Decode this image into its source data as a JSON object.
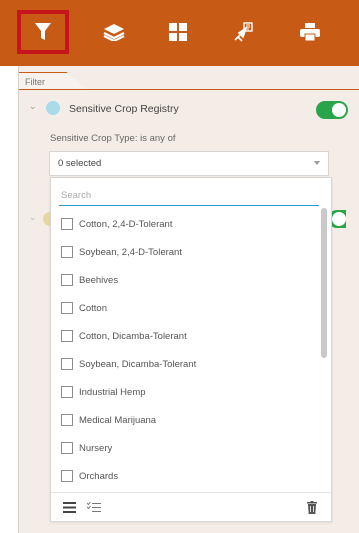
{
  "toolbar": {
    "active": "filter",
    "colors": {
      "bar": "#c75a14",
      "active_border": "#c4161c"
    }
  },
  "panel": {
    "tab_label": "Filter"
  },
  "layer1": {
    "title": "Sensitive Crop Registry",
    "dot_color": "#a9dbe8",
    "toggle_on": true,
    "expression_label": "Sensitive Crop Type: is any of",
    "select_value": "0 selected"
  },
  "dropdown": {
    "search_placeholder": "Search",
    "options": [
      "Cotton, 2,4-D-Tolerant",
      "Soybean, 2,4-D-Tolerant",
      "Beehives",
      "Cotton",
      "Cotton, Dicamba-Tolerant",
      "Soybean, Dicamba-Tolerant",
      "Industrial Hemp",
      "Medical Marijuana",
      "Nursery",
      "Orchards"
    ]
  }
}
